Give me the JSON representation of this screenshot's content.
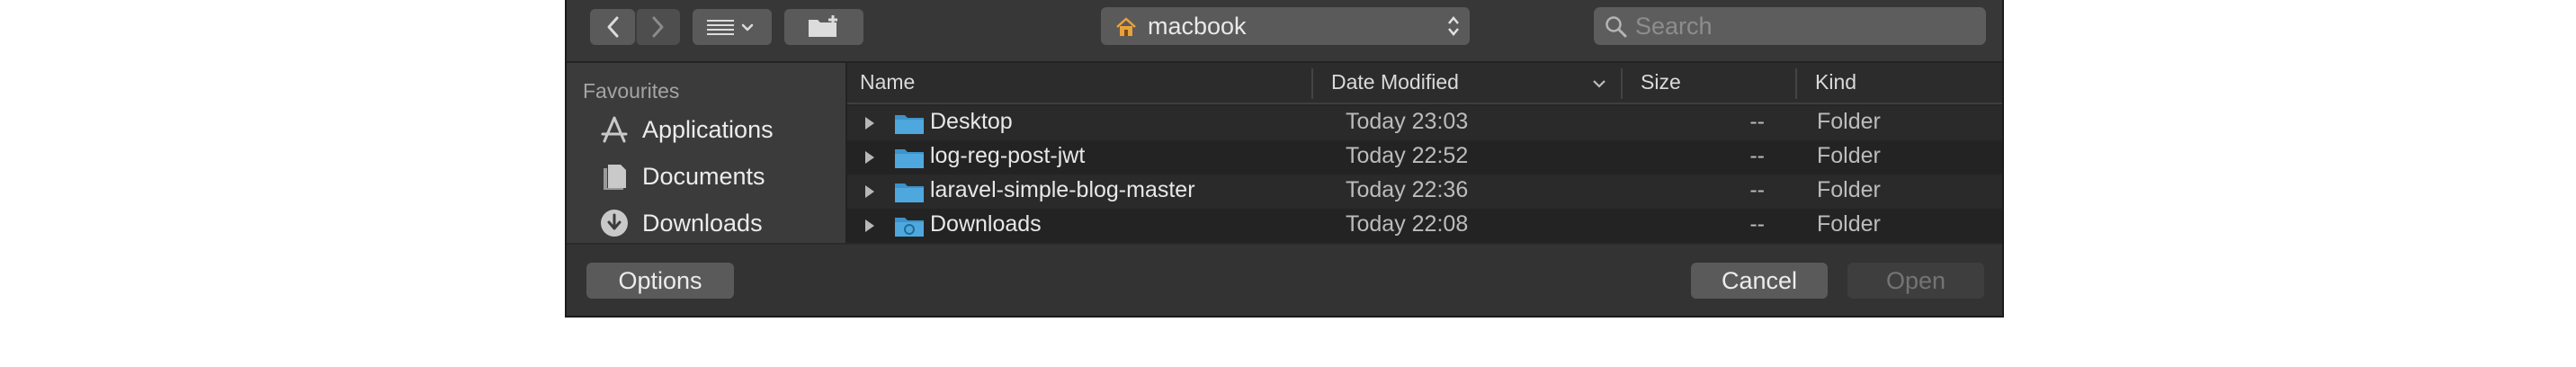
{
  "toolbar": {
    "back_icon": "chevron-left-icon",
    "forward_icon": "chevron-right-icon",
    "view_icon": "list-view-icon",
    "new_folder_icon": "new-folder-icon",
    "location": "macbook",
    "location_icon": "home-icon",
    "search_placeholder": "Search"
  },
  "sidebar": {
    "heading": "Favourites",
    "items": [
      {
        "label": "Applications",
        "icon": "applications-icon"
      },
      {
        "label": "Documents",
        "icon": "documents-icon"
      },
      {
        "label": "Downloads",
        "icon": "downloads-icon"
      }
    ]
  },
  "columns": {
    "name": "Name",
    "date": "Date Modified",
    "size": "Size",
    "kind": "Kind"
  },
  "files": [
    {
      "name": "Desktop",
      "date": "Today 23:03",
      "size": "--",
      "kind": "Folder"
    },
    {
      "name": "log-reg-post-jwt",
      "date": "Today 22:52",
      "size": "--",
      "kind": "Folder"
    },
    {
      "name": "laravel-simple-blog-master",
      "date": "Today 22:36",
      "size": "--",
      "kind": "Folder"
    },
    {
      "name": "Downloads",
      "date": "Today 22:08",
      "size": "--",
      "kind": "Folder"
    }
  ],
  "footer": {
    "options_label": "Options",
    "cancel_label": "Cancel",
    "open_label": "Open"
  },
  "colors": {
    "folder_blue": "#4fa8dd",
    "dialog_bg": "#2f2e2e"
  }
}
